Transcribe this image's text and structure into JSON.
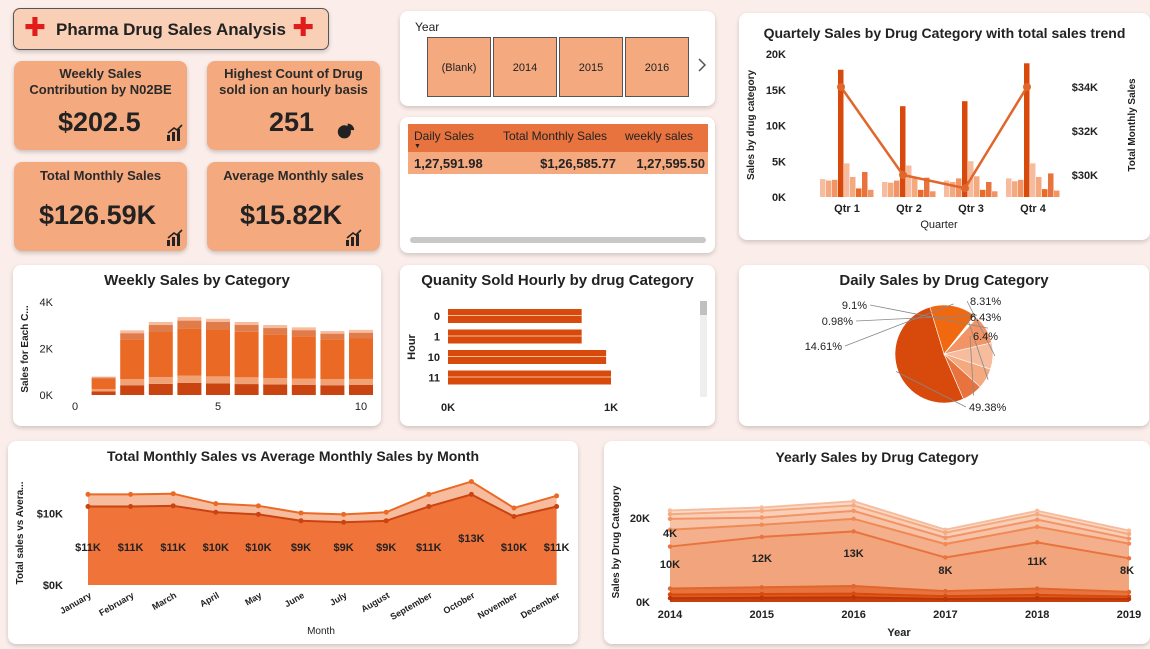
{
  "header": {
    "title": "Pharma Drug Sales Analysis",
    "icon": "red-cross-icon"
  },
  "kpis": [
    {
      "title": "Weekly Sales Contribution by N02BE",
      "value": "$202.5",
      "icon": "bar-chart-up-icon"
    },
    {
      "title": "Highest Count of Drug sold ion an hourly basis",
      "value": "251",
      "icon": "pie-icon"
    },
    {
      "title": "Total Monthly Sales",
      "value": "$126.59K",
      "icon": "bar-chart-up-icon"
    },
    {
      "title": "Average Monthly sales",
      "value": "$15.82K",
      "icon": "bar-chart-up-icon"
    }
  ],
  "year_slicer": {
    "label": "Year",
    "options": [
      "(Blank)",
      "2014",
      "2015",
      "2016"
    ],
    "next_icon": "chevron-right-icon"
  },
  "sales_table": {
    "columns": [
      "Daily Sales",
      "Total Monthly Sales",
      "weekly sales"
    ],
    "row": [
      "1,27,591.98",
      "$1,26,585.77",
      "1,27,595.50"
    ]
  },
  "colors": {
    "dark": "#d84a0c",
    "mid": "#ea6a25",
    "light": "#f29466",
    "pale": "#f7bc9d",
    "kpi": "#f4a97f"
  },
  "chart_data": [
    {
      "id": "quarterly",
      "type": "bar",
      "title": "Quartely Sales by Drug Category with total sales trend",
      "xlabel": "Quarter",
      "ylabel": "Sales by drug category",
      "y2label": "Total Monthly Sales",
      "categories": [
        "Qtr 1",
        "Qtr 2",
        "Qtr 3",
        "Qtr 4"
      ],
      "ylim": [
        0,
        20000
      ],
      "yticks": [
        "0K",
        "5K",
        "10K",
        "15K",
        "20K"
      ],
      "y2ticks": [
        "$30K",
        "$32K",
        "$34K"
      ],
      "y2lim": [
        29000,
        35500
      ],
      "series_values": [
        [
          2500,
          2100,
          2300,
          2600
        ],
        [
          2300,
          2000,
          2100,
          2200
        ],
        [
          2400,
          2300,
          2600,
          2400
        ],
        [
          17800,
          12700,
          13400,
          18700
        ],
        [
          4700,
          4400,
          5000,
          4700
        ],
        [
          2800,
          2600,
          2900,
          2800
        ],
        [
          1200,
          1000,
          1000,
          1100
        ],
        [
          3500,
          2700,
          2100,
          3300
        ],
        [
          1000,
          800,
          800,
          900
        ]
      ],
      "line_values": [
        34000,
        30000,
        29400,
        34000
      ]
    },
    {
      "id": "weekly",
      "type": "bar",
      "title": "Weekly Sales by Category",
      "ylabel": "Sales for Each C...",
      "xticks": [
        "0",
        "5",
        "10"
      ],
      "yticks": [
        "0K",
        "2K",
        "4K"
      ],
      "ylim": [
        0,
        4000
      ],
      "x": [
        1,
        2,
        3,
        4,
        5,
        6,
        7,
        8,
        9,
        10
      ],
      "series_values": [
        [
          150,
          420,
          480,
          520,
          500,
          470,
          450,
          440,
          420,
          430
        ],
        [
          100,
          260,
          290,
          310,
          300,
          290,
          280,
          270,
          260,
          260
        ],
        [
          440,
          1720,
          1940,
          2040,
          2020,
          1960,
          1880,
          1820,
          1720,
          1740
        ],
        [
          60,
          260,
          300,
          330,
          320,
          290,
          270,
          260,
          240,
          250
        ],
        [
          40,
          120,
          130,
          150,
          140,
          130,
          130,
          120,
          110,
          120
        ]
      ]
    },
    {
      "id": "hourly",
      "type": "bar",
      "title": "Quanity Sold Hourly by drug Category",
      "ylabel": "Hour",
      "categories": [
        "0",
        "1",
        "10",
        "11"
      ],
      "xticks": [
        "0K",
        "1K"
      ],
      "xlim": [
        0,
        1000
      ],
      "values": [
        820,
        820,
        970,
        1000
      ]
    },
    {
      "id": "daily",
      "type": "pie",
      "title": "Daily Sales by Drug Category",
      "labels": [
        "49.38%",
        "14.61%",
        "0.98%",
        "9.1%",
        "8.31%",
        "6.43%",
        "6.4%"
      ],
      "values": [
        49.38,
        14.61,
        0.98,
        9.1,
        8.31,
        6.43,
        6.4
      ]
    },
    {
      "id": "monthly",
      "type": "area",
      "title": "Total Monthly Sales vs Average Monthly Sales by Month",
      "xlabel": "Month",
      "ylabel": "Total sales vs Avera...",
      "yticks": [
        "$0K",
        "$10K"
      ],
      "ylim": [
        0,
        15000
      ],
      "categories": [
        "January",
        "February",
        "March",
        "April",
        "May",
        "June",
        "July",
        "August",
        "September",
        "October",
        "November",
        "December"
      ],
      "total_values": [
        12700,
        12700,
        12800,
        11400,
        11100,
        10100,
        9900,
        10200,
        12700,
        14500,
        10800,
        12500
      ],
      "average_values": [
        11000,
        11000,
        11100,
        10200,
        9900,
        9000,
        8800,
        9000,
        11000,
        12700,
        9600,
        11000
      ],
      "data_labels": [
        "$11K",
        "$11K",
        "$11K",
        "$10K",
        "$10K",
        "$9K",
        "$9K",
        "$9K",
        "$11K",
        "$13K",
        "$10K",
        "$11K"
      ]
    },
    {
      "id": "yearly",
      "type": "area",
      "title": "Yearly Sales by Drug Category",
      "xlabel": "Year",
      "ylabel": "Sales by Drug Category",
      "yticks": [
        "0K",
        "20K"
      ],
      "ylim": [
        0,
        30000
      ],
      "categories": [
        "2014",
        "2015",
        "2016",
        "2017",
        "2018",
        "2019"
      ],
      "stack_tops": [
        [
          900,
          1000,
          1100,
          700,
          900,
          700
        ],
        [
          1800,
          1900,
          2000,
          1400,
          1700,
          1300
        ],
        [
          3200,
          3500,
          3800,
          2600,
          3200,
          2400
        ],
        [
          13200,
          15500,
          16800,
          10600,
          14200,
          10400
        ],
        [
          17200,
          18400,
          19800,
          13800,
          17900,
          13900
        ],
        [
          19800,
          20100,
          21700,
          15300,
          19600,
          15100
        ],
        [
          20900,
          21700,
          23000,
          16500,
          20900,
          16200
        ],
        [
          21800,
          22500,
          24000,
          17200,
          21700,
          17000
        ]
      ],
      "data_labels": [
        {
          "x": "2014",
          "text": "4K"
        },
        {
          "x": "2014",
          "text": "10K"
        },
        {
          "x": "2015",
          "text": "12K"
        },
        {
          "x": "2016",
          "text": "13K"
        },
        {
          "x": "2017",
          "text": "8K"
        },
        {
          "x": "2018",
          "text": "11K"
        },
        {
          "x": "2019",
          "text": "8K"
        }
      ]
    }
  ]
}
